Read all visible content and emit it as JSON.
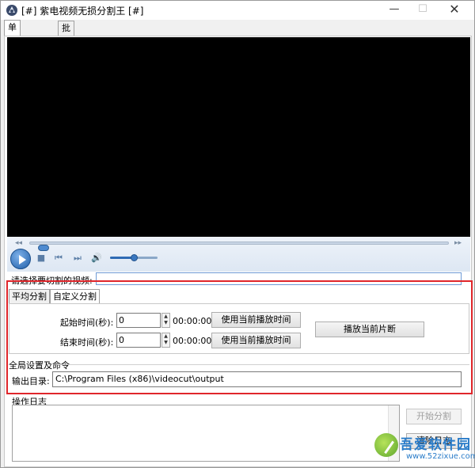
{
  "window": {
    "title": "[#] 紫电视频无损分割王 [#]",
    "minimize_glyph": "—",
    "maximize_glyph": "☐",
    "close_glyph": "✕"
  },
  "main_tabs": [
    {
      "label": "单文件切割",
      "active": true
    },
    {
      "label": "批量切割",
      "active": false
    }
  ],
  "player": {
    "seek_position": 0.02,
    "volume_level": 0.5,
    "seek_left_glyph": "◂◂",
    "seek_right_glyph": "▸▸",
    "stop_glyph": "■",
    "prev_glyph": "⏮",
    "next_glyph": "⏭",
    "volume_glyph": "🔊"
  },
  "file_select": {
    "label": "请选择要切割的视频:",
    "value": ""
  },
  "split_tabs": [
    {
      "label": "平均分割",
      "active": false
    },
    {
      "label": "自定义分割",
      "active": true
    }
  ],
  "custom_split": {
    "start_label": "起始时间(秒):",
    "start_value": "0",
    "start_time": "00:00:00",
    "end_label": "结束时间(秒):",
    "end_value": "0",
    "end_time": "00:00:00",
    "use_current_start": "使用当前播放时间",
    "use_current_end": "使用当前播放时间",
    "play_segment": "播放当前片断"
  },
  "global": {
    "group_label": "全局设置及命令",
    "output_label": "输出目录:",
    "output_value": "C:\\Program Files (x86)\\videocut\\output"
  },
  "log": {
    "label": "操作日志",
    "start_button": "开始分割",
    "clear_button": "清除日志"
  },
  "watermark": {
    "text": "吾爱软件园",
    "url": "www.52zixue.com"
  },
  "colors": {
    "highlight_box": "#e0262b",
    "video_bg": "#000000",
    "accent": "#2a7cc9"
  }
}
